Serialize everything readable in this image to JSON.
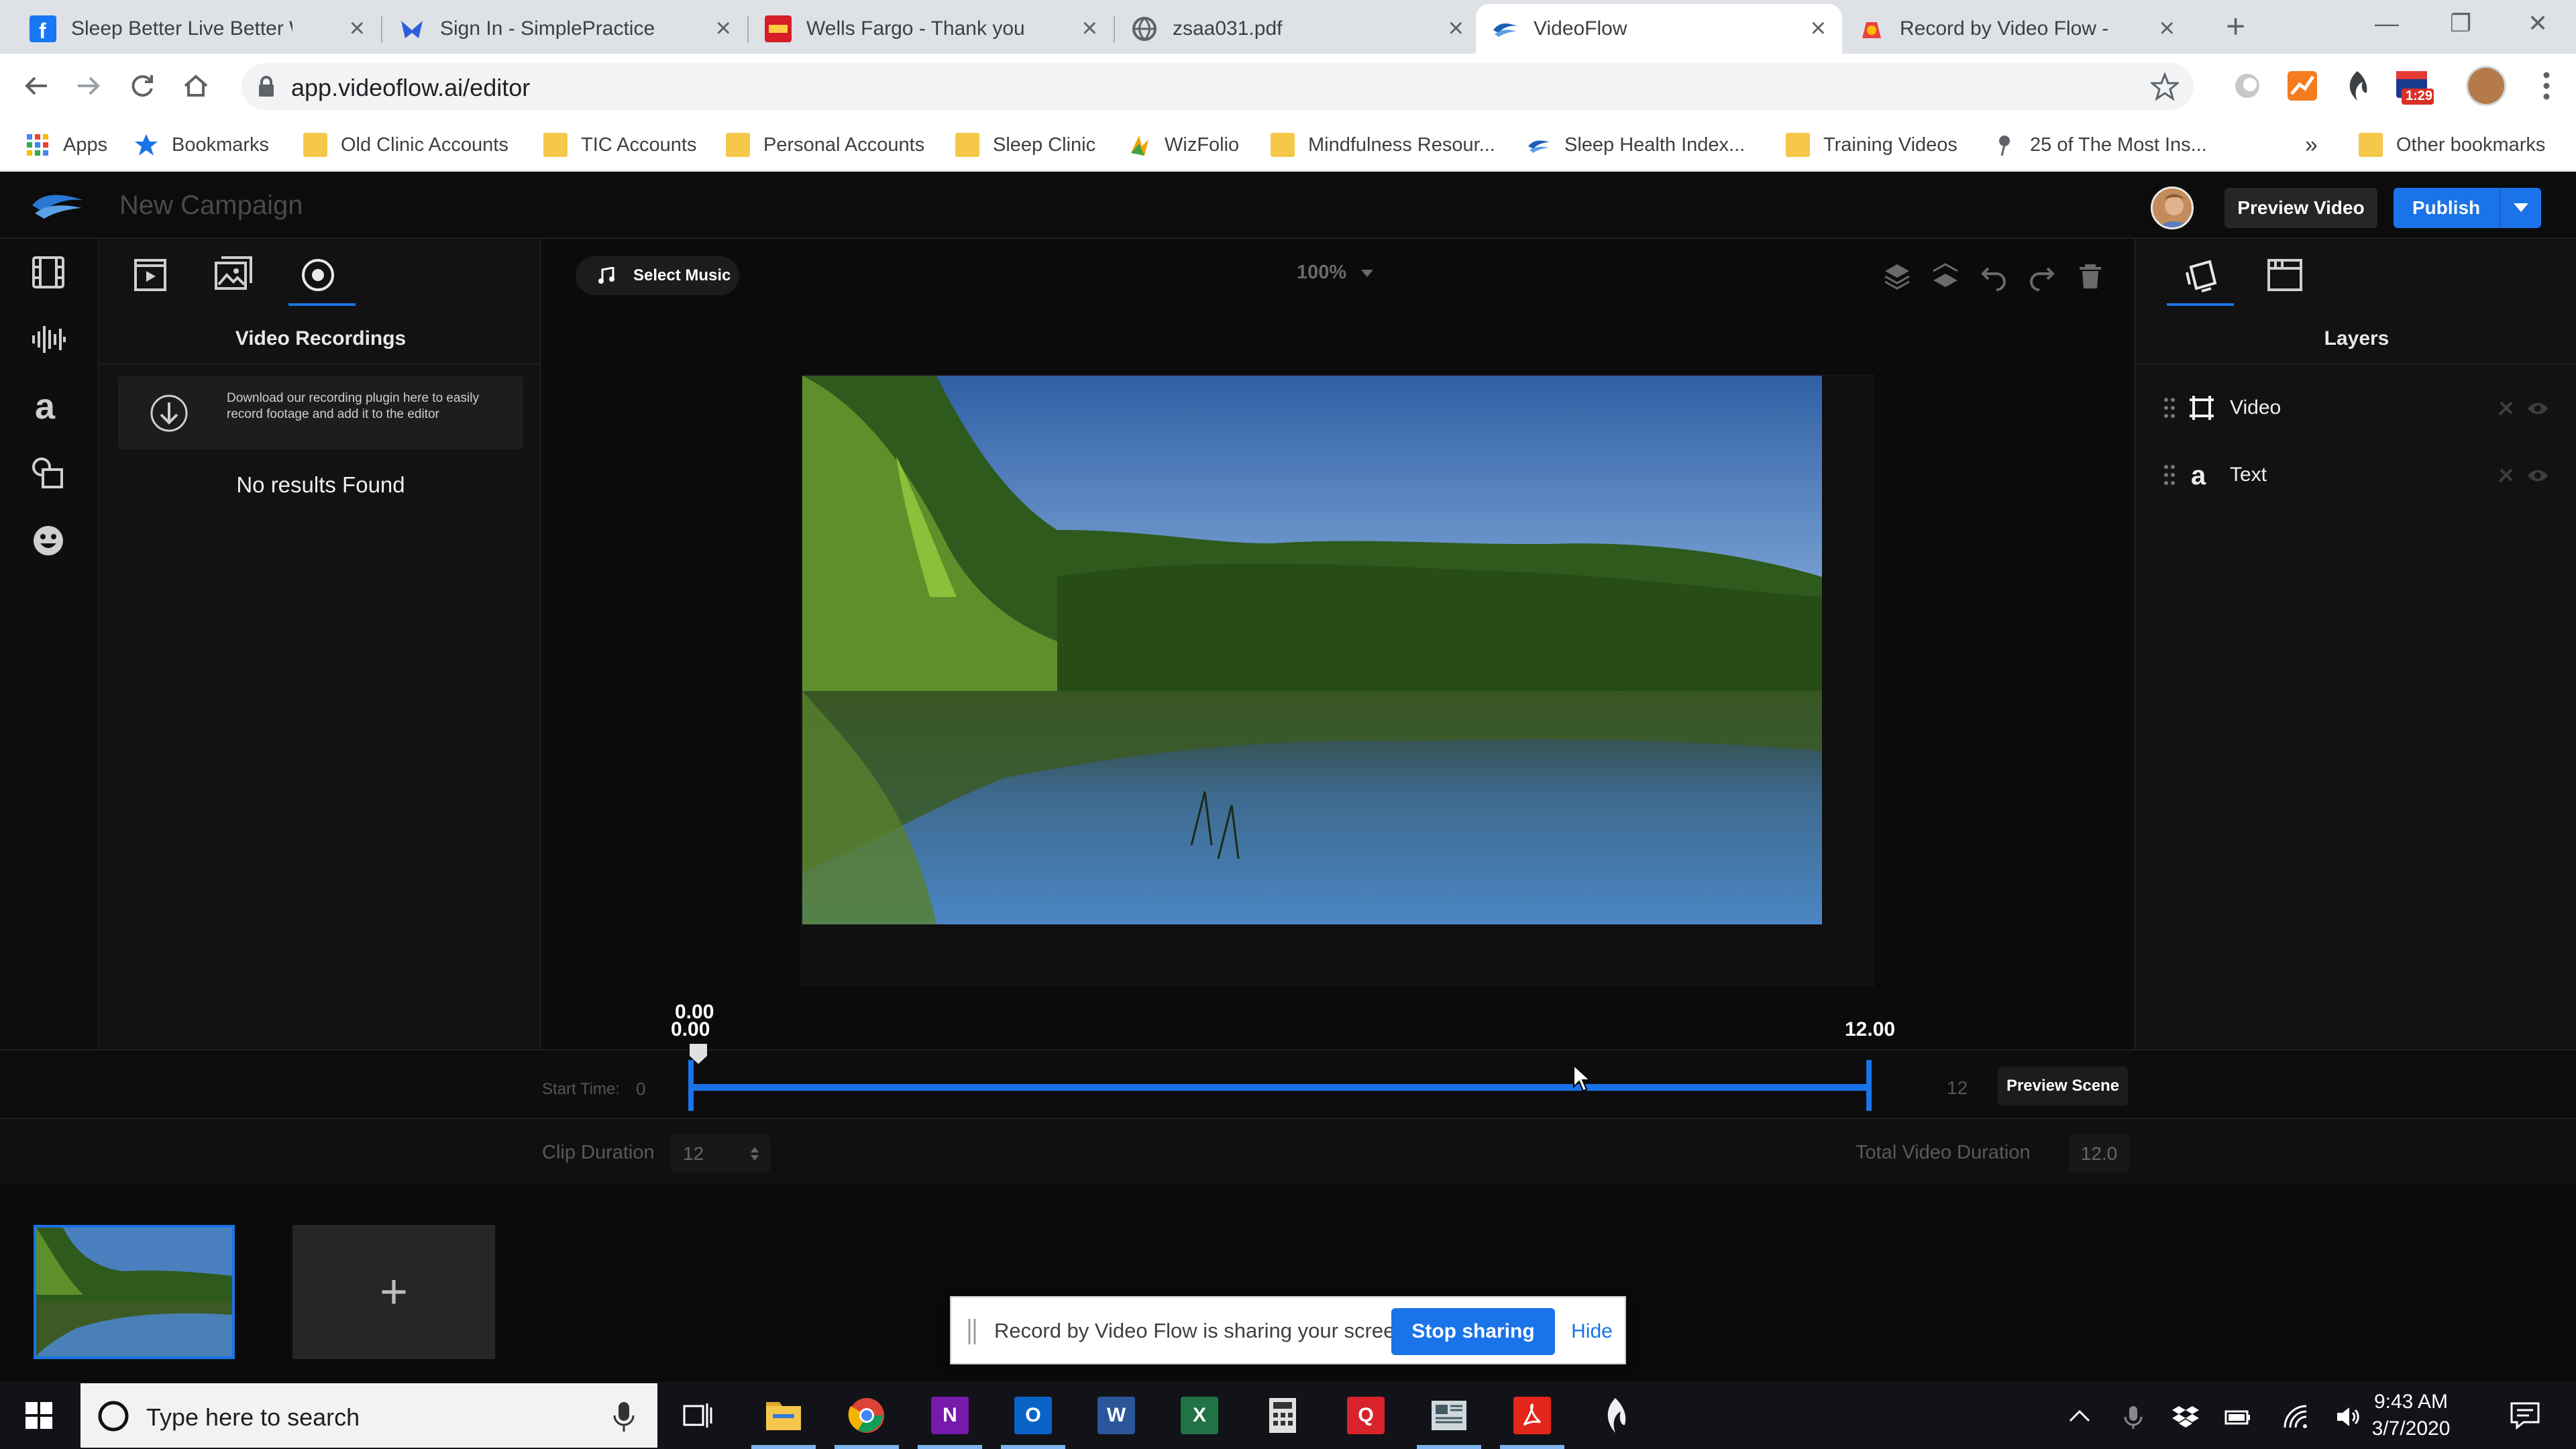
{
  "browser": {
    "tabs": [
      {
        "label": "Sleep Better Live Better Work",
        "icon": "facebook-icon",
        "color": "#1877f2"
      },
      {
        "label": "Sign In - SimplePractice",
        "icon": "simplepractice-icon",
        "color": "#2b5fd9"
      },
      {
        "label": "Wells Fargo - Thank you for",
        "icon": "wells-fargo-icon",
        "color": "#d71e28"
      },
      {
        "label": "zsaa031.pdf",
        "icon": "globe-icon",
        "color": "#5f6368"
      },
      {
        "label": "VideoFlow",
        "icon": "videoflow-icon",
        "color": "#1a5fb4"
      },
      {
        "label": "Record by Video Flow - Chro",
        "icon": "chrome-web-store-icon",
        "color": "#e8453c"
      }
    ],
    "active_tab": 4,
    "new_tab": "+",
    "url": "app.videoflow.ai/editor",
    "bookmarks": [
      {
        "label": "Apps",
        "icon": "apps-grid-icon"
      },
      {
        "label": "Bookmarks",
        "icon": "star-icon"
      },
      {
        "label": "Old Clinic Accounts",
        "icon": "folder-icon"
      },
      {
        "label": "TIC Accounts",
        "icon": "folder-icon"
      },
      {
        "label": "Personal Accounts",
        "icon": "folder-icon"
      },
      {
        "label": "Sleep Clinic",
        "icon": "folder-icon"
      },
      {
        "label": "WizFolio",
        "icon": "wizfolio-icon"
      },
      {
        "label": "Mindfulness Resour...",
        "icon": "folder-icon"
      },
      {
        "label": "Sleep Health Index...",
        "icon": "videoflow-icon"
      },
      {
        "label": "Training Videos",
        "icon": "folder-icon"
      },
      {
        "label": "25 of The Most Ins...",
        "icon": "pin-icon"
      }
    ],
    "more_bookmarks": "»",
    "other_bookmarks": "Other bookmarks",
    "extension_badge": "1:29"
  },
  "app": {
    "campaign_name": "New Campaign",
    "preview_video": "Preview Video",
    "publish": "Publish",
    "left_panel": {
      "title": "Video Recordings",
      "plugin_notice": "Download our recording plugin here to easily record footage and add it to the editor",
      "empty_state": "No results Found"
    },
    "select_music": "Select Music",
    "zoom": "100%",
    "right_panel": {
      "title": "Layers",
      "layers": [
        {
          "label": "Video",
          "icon": "video-frame-icon"
        },
        {
          "label": "Text",
          "icon": "text-a-icon"
        }
      ]
    },
    "timeline": {
      "start_time_label": "Start Time:",
      "start_time_value": "0",
      "knob_value_top": "0.00",
      "knob_value_bottom": "0.00",
      "end_marker_value": "12.00",
      "end_value": "12",
      "preview_scene": "Preview Scene"
    },
    "clip_duration_label": "Clip Duration",
    "clip_duration_value": "12",
    "total_duration_label": "Total Video Duration",
    "total_duration_value": "12.0",
    "add_scene": "+"
  },
  "share_notice": {
    "message": "Record by Video Flow is sharing your screen.",
    "stop": "Stop sharing",
    "hide": "Hide"
  },
  "taskbar": {
    "search_placeholder": "Type here to search",
    "time": "9:43 AM",
    "date": "3/7/2020",
    "apps": [
      "file-explorer-icon",
      "chrome-icon",
      "onenote-icon",
      "outlook-icon",
      "word-icon",
      "excel-icon",
      "calculator-icon",
      "quicken-icon",
      "news-icon",
      "acrobat-icon",
      "dragon-icon"
    ]
  }
}
